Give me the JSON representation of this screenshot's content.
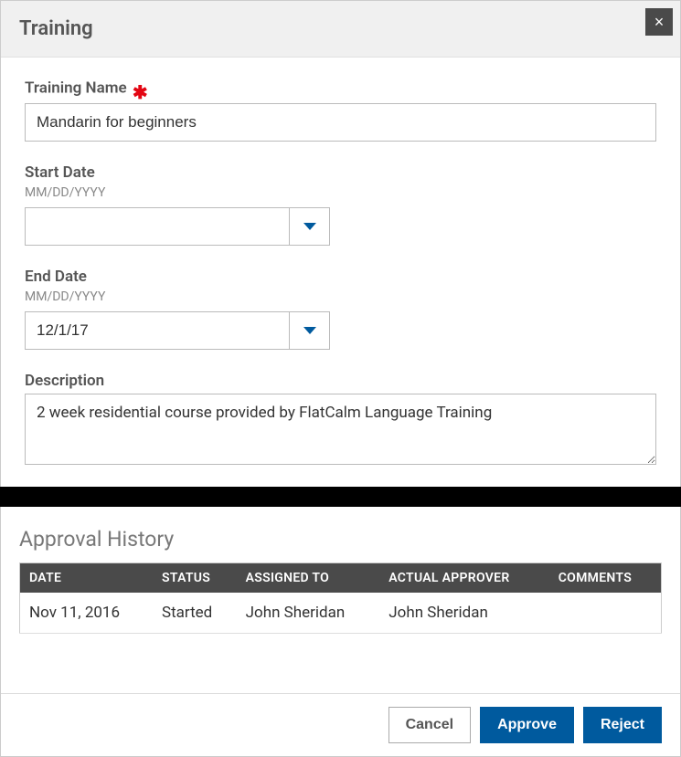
{
  "modal": {
    "title": "Training",
    "close_icon": "×"
  },
  "form": {
    "training_name": {
      "label": "Training Name",
      "value": "Mandarin for beginners"
    },
    "start_date": {
      "label": "Start Date",
      "hint": "MM/DD/YYYY",
      "value": ""
    },
    "end_date": {
      "label": "End Date",
      "hint": "MM/DD/YYYY",
      "value": "12/1/17"
    },
    "description": {
      "label": "Description",
      "value": "2 week residential course provided by FlatCalm Language Training"
    }
  },
  "approval": {
    "title": "Approval History",
    "columns": {
      "date": "DATE",
      "status": "STATUS",
      "assigned_to": "ASSIGNED TO",
      "actual_approver": "ACTUAL APPROVER",
      "comments": "COMMENTS"
    },
    "rows": [
      {
        "date": "Nov 11, 2016",
        "status": "Started",
        "assigned_to": "John Sheridan",
        "actual_approver": "John Sheridan",
        "comments": ""
      }
    ]
  },
  "footer": {
    "cancel": "Cancel",
    "approve": "Approve",
    "reject": "Reject"
  }
}
